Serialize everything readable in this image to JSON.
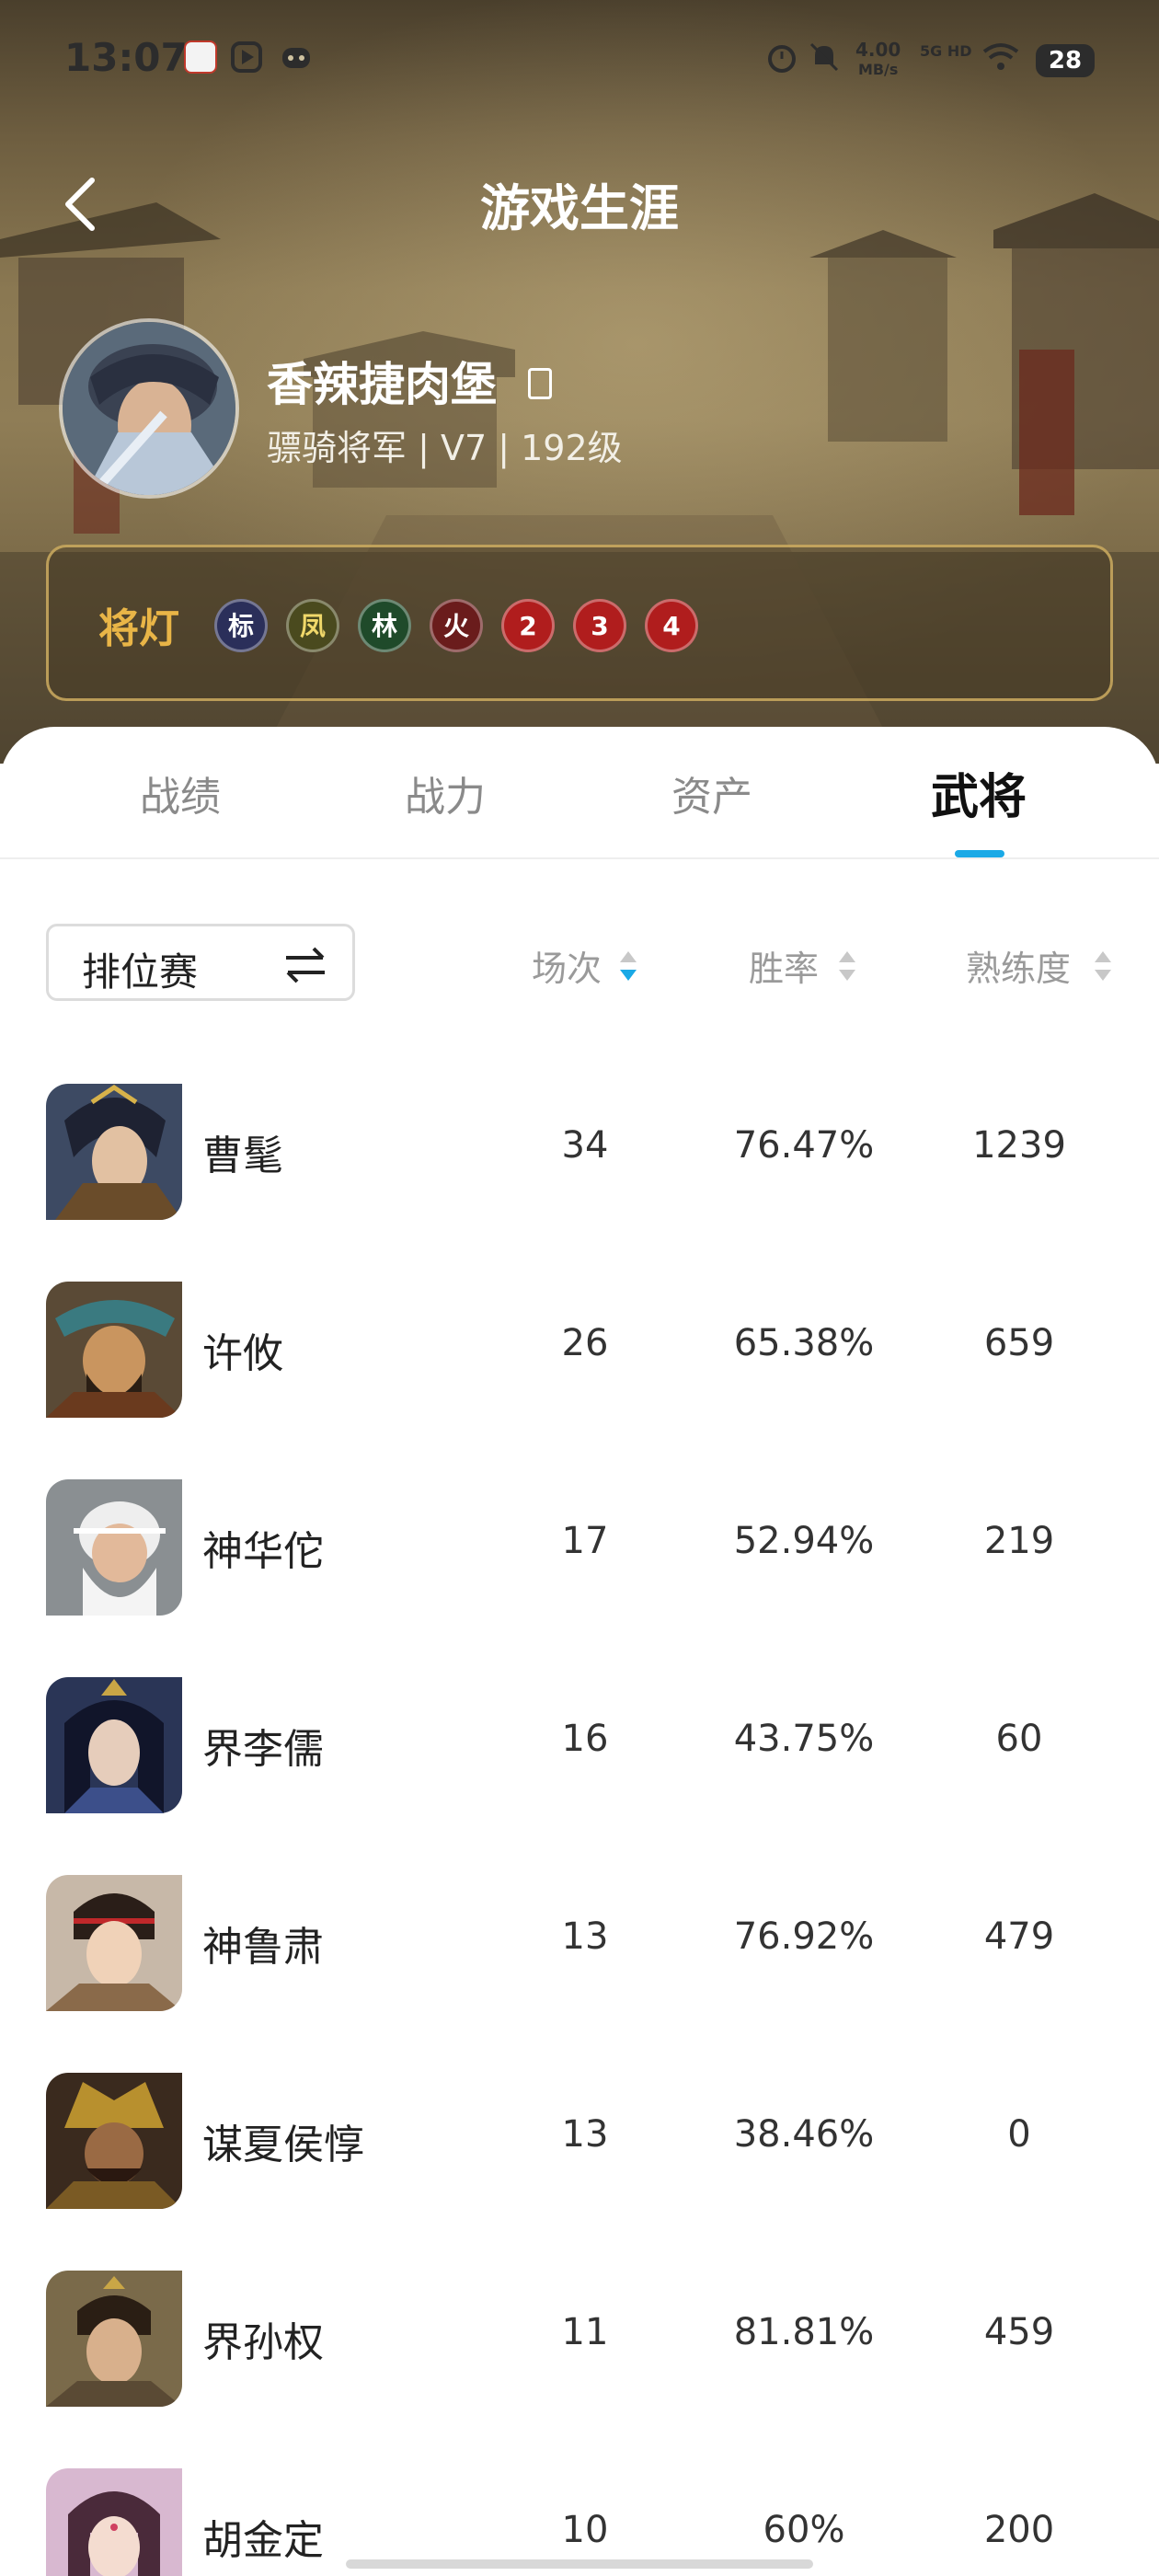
{
  "status_bar": {
    "time": "13:07",
    "net_speed_top": "4.00",
    "net_speed_bottom": "MB/s",
    "signal": "5G HD",
    "battery": "28"
  },
  "header": {
    "title": "游戏生涯"
  },
  "profile": {
    "name": "香辣捷肉堡",
    "meta": "骠骑将军 | V7 | 192级"
  },
  "lamps": {
    "title": "将灯",
    "items": [
      {
        "label": "标",
        "color": "#2b2f5a"
      },
      {
        "label": "凤",
        "color": "#4a4a1e"
      },
      {
        "label": "林",
        "color": "#1f4a2a"
      },
      {
        "label": "火",
        "color": "#6a1c1c"
      },
      {
        "label": "2",
        "color": "#b01d1d"
      },
      {
        "label": "3",
        "color": "#b01d1d"
      },
      {
        "label": "4",
        "color": "#b01d1d"
      }
    ]
  },
  "tabs": [
    {
      "label": "战绩"
    },
    {
      "label": "战力"
    },
    {
      "label": "资产"
    },
    {
      "label": "武将"
    }
  ],
  "filter": {
    "mode": "排位赛"
  },
  "columns": {
    "games": "场次",
    "win_rate": "胜率",
    "proficiency": "熟练度"
  },
  "accent_color": "#1aa9e6",
  "generals": [
    {
      "name": "曹髦",
      "games": "34",
      "win_rate": "76.47%",
      "proficiency": "1239"
    },
    {
      "name": "许攸",
      "games": "26",
      "win_rate": "65.38%",
      "proficiency": "659"
    },
    {
      "name": "神华佗",
      "games": "17",
      "win_rate": "52.94%",
      "proficiency": "219"
    },
    {
      "name": "界李儒",
      "games": "16",
      "win_rate": "43.75%",
      "proficiency": "60"
    },
    {
      "name": "神鲁肃",
      "games": "13",
      "win_rate": "76.92%",
      "proficiency": "479"
    },
    {
      "name": "谋夏侯惇",
      "games": "13",
      "win_rate": "38.46%",
      "proficiency": "0"
    },
    {
      "name": "界孙权",
      "games": "11",
      "win_rate": "81.81%",
      "proficiency": "459"
    },
    {
      "name": "胡金定",
      "games": "10",
      "win_rate": "60%",
      "proficiency": "200"
    }
  ]
}
